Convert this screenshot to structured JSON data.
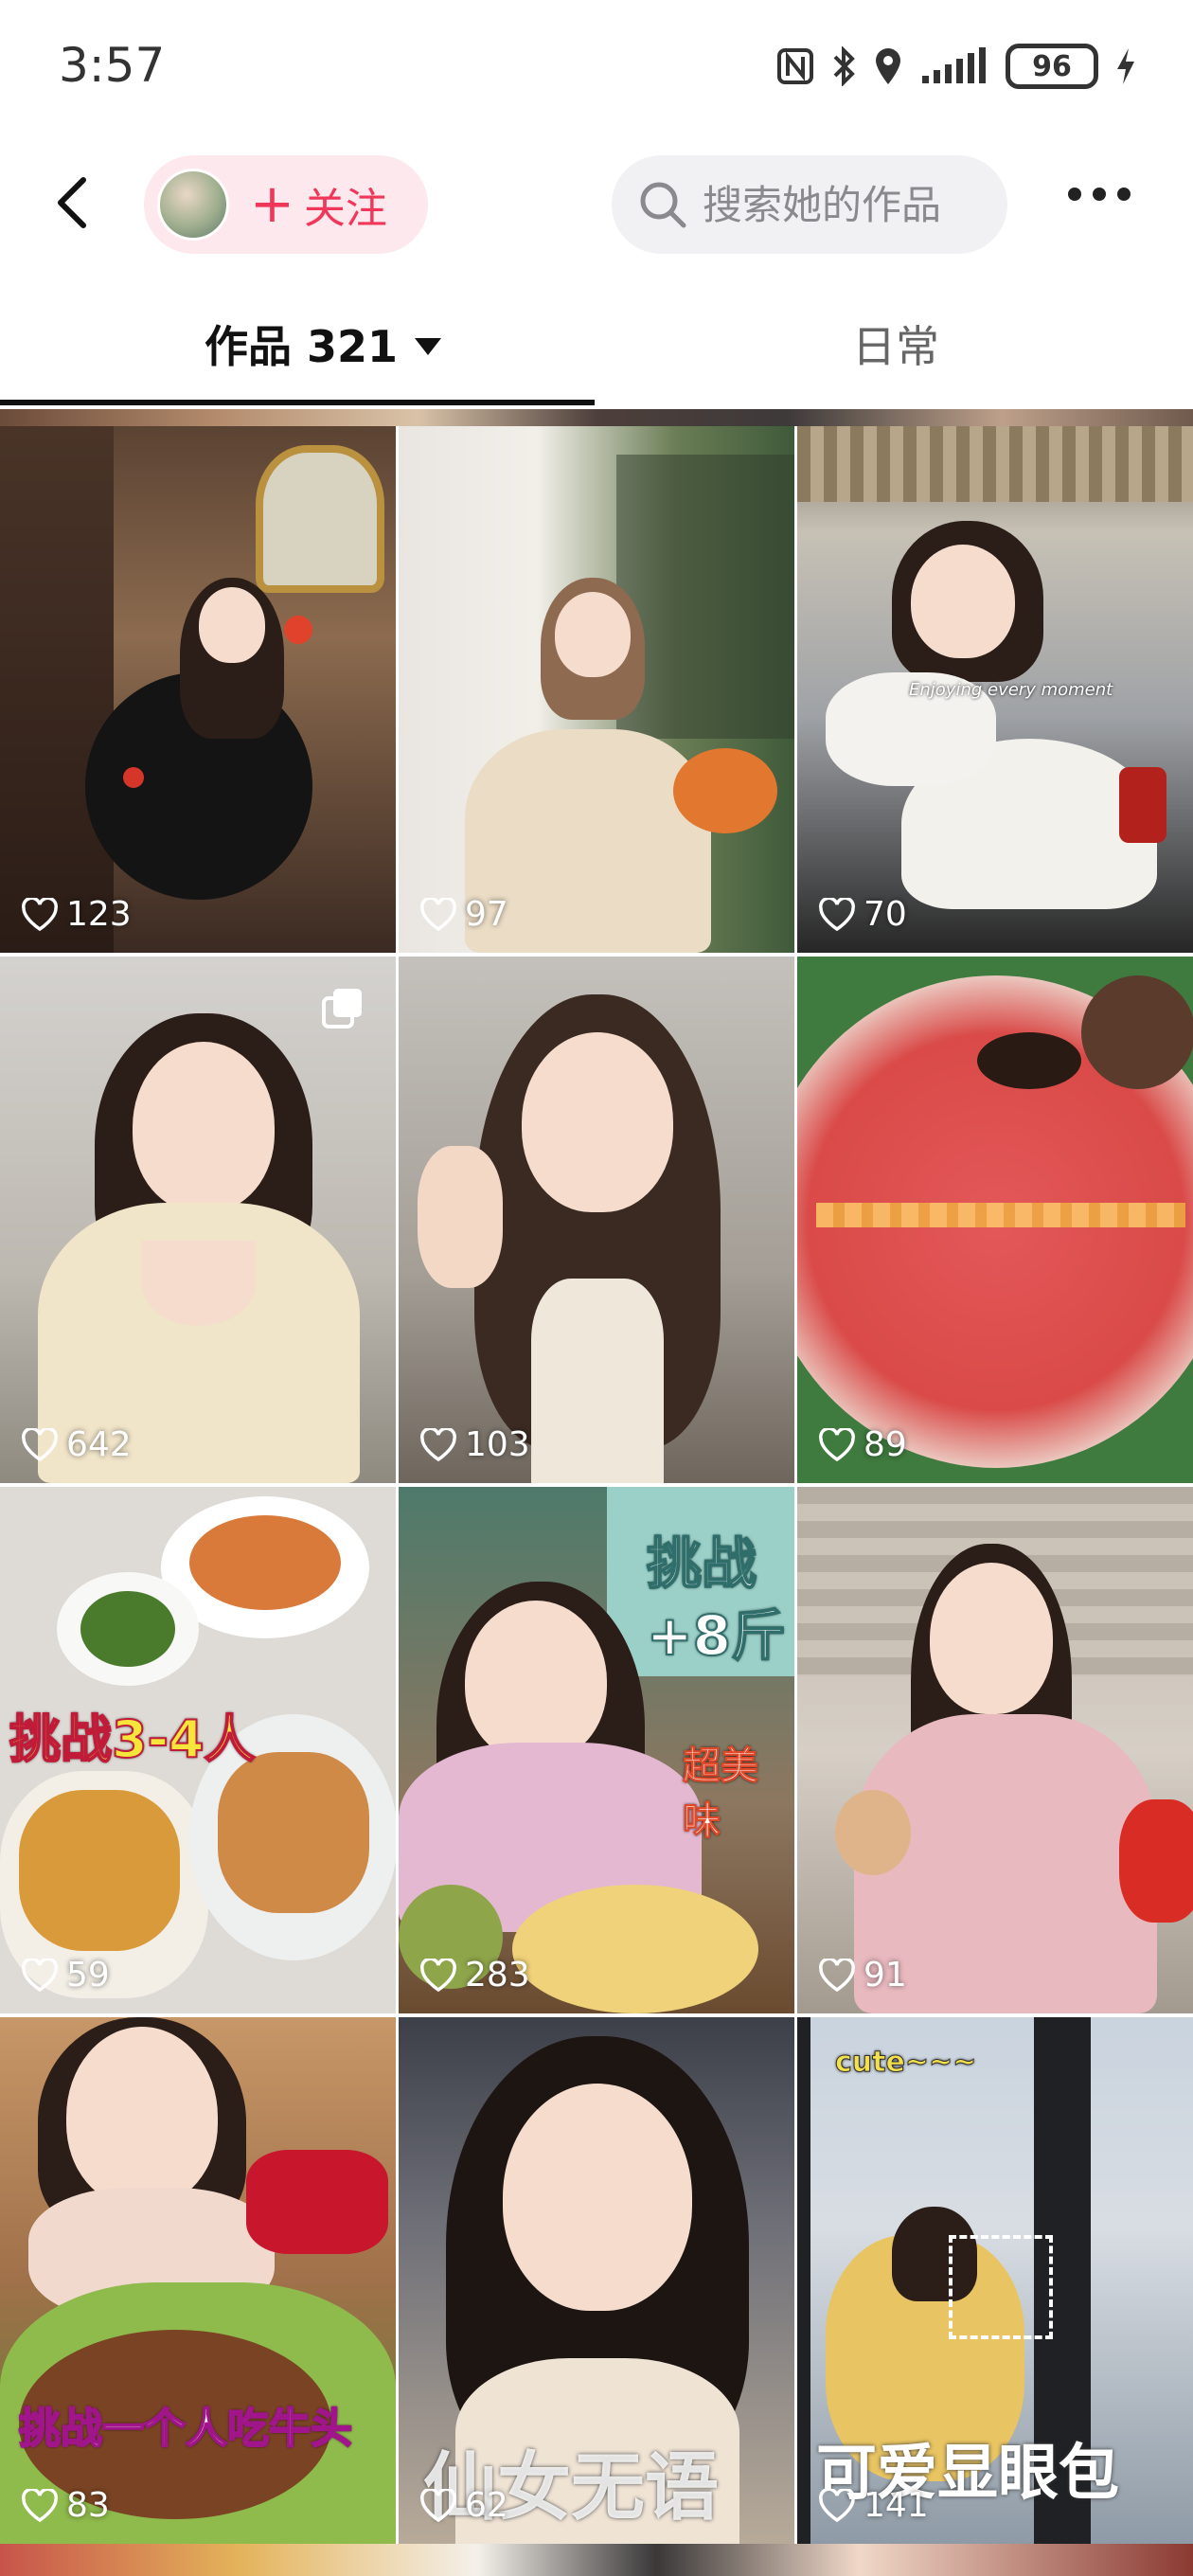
{
  "status_bar": {
    "time": "3:57",
    "battery": "96",
    "icons": [
      "nfc-icon",
      "bluetooth-icon",
      "location-icon",
      "signal-icon",
      "battery-icon",
      "charging-icon"
    ]
  },
  "nav": {
    "back_icon": "back-arrow-icon",
    "follow_label": "关注",
    "follow_plus": "+",
    "search_placeholder": "搜索她的作品",
    "more_icon": "more-dots-icon"
  },
  "tabs": [
    {
      "label": "作品 321",
      "active": true
    },
    {
      "label": "日常",
      "active": false
    }
  ],
  "colors": {
    "accent": "#f0375a",
    "follow_bg": "#fde8ee",
    "search_bg": "#f1f1f3"
  },
  "grid": {
    "items": [
      {
        "likes": "123",
        "overlay": ""
      },
      {
        "likes": "97",
        "overlay": ""
      },
      {
        "likes": "70",
        "overlay": "Enjoying every moment"
      },
      {
        "likes": "642",
        "overlay": "",
        "multi_image": true
      },
      {
        "likes": "103",
        "overlay": ""
      },
      {
        "likes": "89",
        "overlay": ""
      },
      {
        "likes": "59",
        "overlay": "挑战3-4人"
      },
      {
        "likes": "283",
        "overlay": "挑战",
        "overlay2": "+8斤",
        "overlay3": "超美味"
      },
      {
        "likes": "91",
        "overlay": ""
      },
      {
        "likes": "83",
        "overlay": "挑战一个人吃牛头"
      },
      {
        "likes": "62",
        "overlay": "仙女无语"
      },
      {
        "likes": "141",
        "overlay": "可爱显眼包",
        "overlay_small": "cute~~~"
      }
    ]
  }
}
